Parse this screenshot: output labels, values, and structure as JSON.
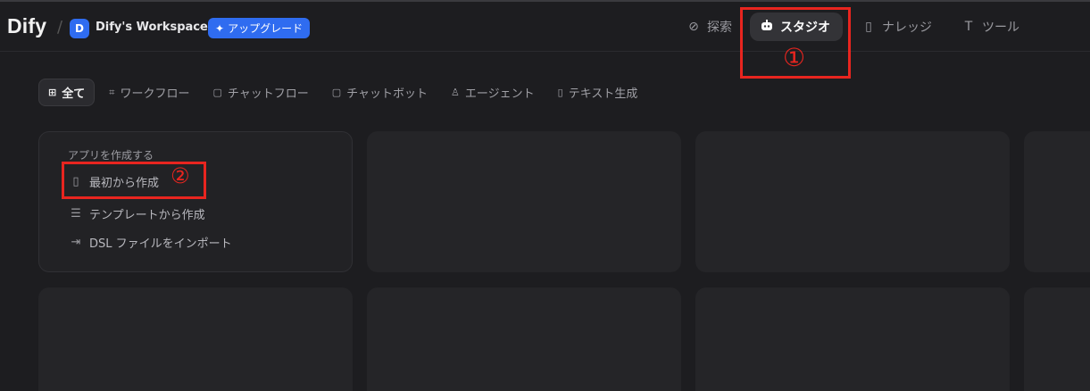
{
  "header": {
    "logo": "Dify",
    "separator": "/",
    "workspace_initial": "D",
    "workspace_name": "Dify's Workspace",
    "workspace_chevron": "chevron-down-icon",
    "upgrade_label": "アップグレード"
  },
  "nav": {
    "items": [
      {
        "label": "探索",
        "icon": "compass-icon"
      },
      {
        "label": "スタジオ",
        "icon": "robot-icon",
        "active": true
      },
      {
        "label": "ナレッジ",
        "icon": "book-icon"
      },
      {
        "label": "ツール",
        "icon": "hammer-icon"
      }
    ]
  },
  "annotations": {
    "one": "①",
    "two": "②",
    "color": "#e8251f"
  },
  "filters": [
    {
      "label": "全て",
      "icon": "grid-icon",
      "active": true
    },
    {
      "label": "ワークフロー",
      "icon": "workflow-icon"
    },
    {
      "label": "チャットフロー",
      "icon": "chatflow-icon"
    },
    {
      "label": "チャットボット",
      "icon": "chatbot-icon"
    },
    {
      "label": "エージェント",
      "icon": "agent-icon"
    },
    {
      "label": "テキスト生成",
      "icon": "text-gen-icon"
    }
  ],
  "create_card": {
    "title": "アプリを作成する",
    "items": [
      {
        "label": "最初から作成",
        "icon": "new-file-icon"
      },
      {
        "label": "テンプレートから作成",
        "icon": "template-icon"
      },
      {
        "label": "DSL ファイルをインポート",
        "icon": "import-icon"
      }
    ]
  },
  "colors": {
    "accent": "#2f6cf0",
    "background": "#1d1d20",
    "card": "#252528"
  }
}
